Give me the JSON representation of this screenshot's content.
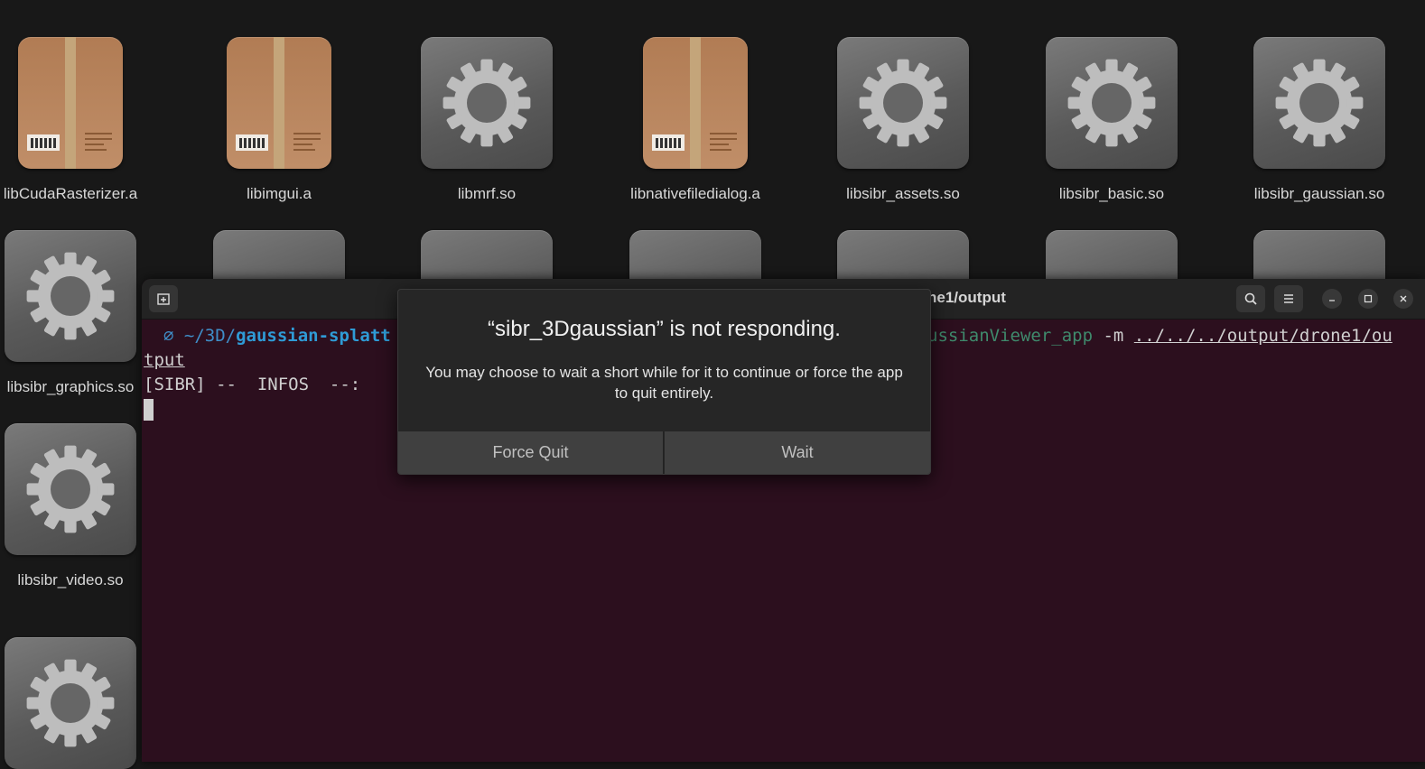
{
  "file_manager": {
    "row1": [
      {
        "name": "libCudaRasterizer.a",
        "icon": "package-icon"
      },
      {
        "name": "libimgui.a",
        "icon": "package-icon"
      },
      {
        "name": "libmrf.so",
        "icon": "gear-icon"
      },
      {
        "name": "libnativefiledialog.a",
        "icon": "package-icon"
      },
      {
        "name": "libsibr_assets.so",
        "icon": "gear-icon"
      },
      {
        "name": "libsibr_basic.so",
        "icon": "gear-icon"
      },
      {
        "name": "libsibr_gaussian.so",
        "icon": "gear-icon"
      }
    ],
    "col_left": [
      {
        "name": "libsibr_graphics.so",
        "icon": "gear-icon"
      },
      {
        "name": "libsibr_video.so",
        "icon": "gear-icon"
      }
    ]
  },
  "terminal": {
    "title": "ne1/output",
    "prompt_symbol": "∅",
    "path_home": "~/3D/",
    "path_bold": "gaussian-splatt",
    "cmd_app": "ussianViewer_app",
    "cmd_flag": " -m ",
    "cmd_arg": "../../../output/drone1/ou",
    "line2": "tput",
    "line3": "[SIBR] --  INFOS  --:"
  },
  "dialog": {
    "title": "“sibr_3Dgaussian” is not responding.",
    "message": "You may choose to wait a short while for it to continue or force the app to quit entirely.",
    "force_quit_label": "Force Quit",
    "wait_label": "Wait"
  },
  "colors": {
    "terminal_bg": "#2c0f1e",
    "desktop_bg": "#181818",
    "dialog_bg": "#262626"
  }
}
